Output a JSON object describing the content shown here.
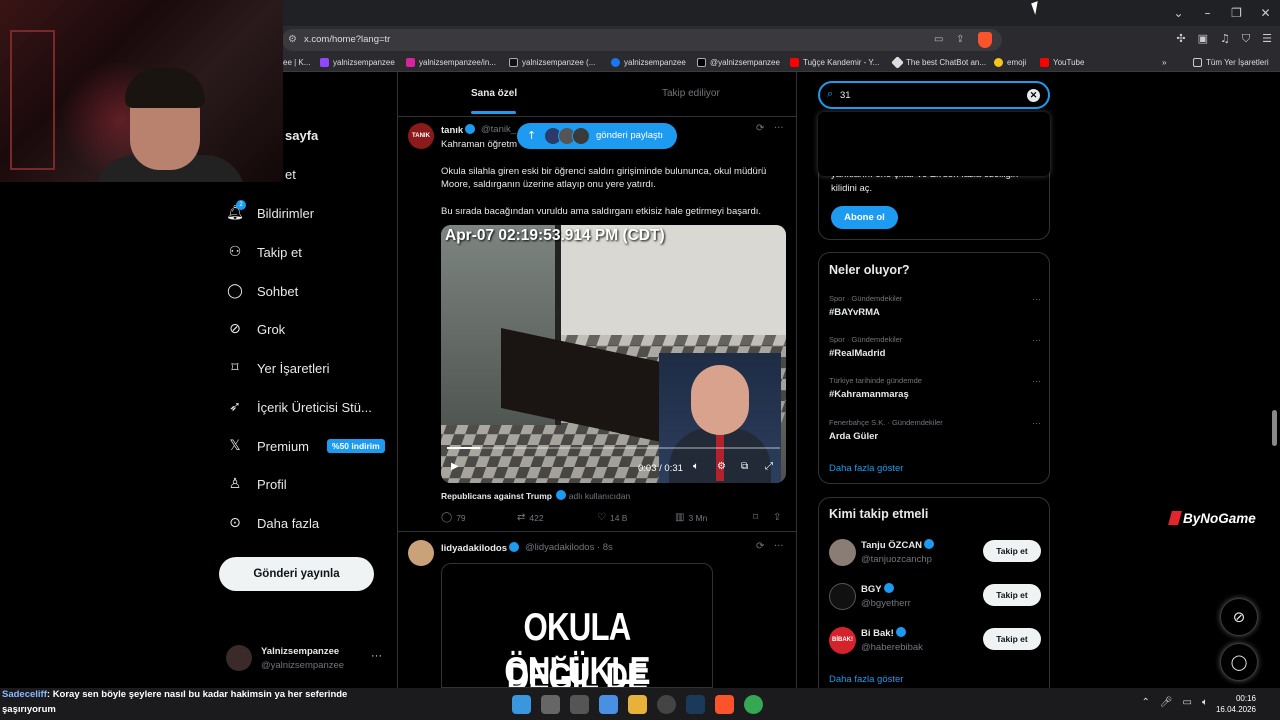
{
  "browser": {
    "url": "x.com/home?lang=tr",
    "bookmarks": [
      "ee | K...",
      "yalnizsempanzee",
      "yalnizsempanzee/in...",
      "yalnizsempanzee (...",
      "yalnizsempanzee",
      "@yalnizsempanzee",
      "Tuğçe Kandemir - Y...",
      "The best ChatBot an...",
      "emoji",
      "YouTube"
    ],
    "all_bookmarks": "Tüm Yer İşaretleri",
    "overflow": "»"
  },
  "nav": {
    "partial_home": "sayfa",
    "partial_explore": "et",
    "items": [
      {
        "label": "Bildirimler",
        "icon": "bell-icon"
      },
      {
        "label": "Takip et",
        "icon": "person-plus-icon"
      },
      {
        "label": "Sohbet",
        "icon": "chat-icon"
      },
      {
        "label": "Grok",
        "icon": "grok-icon"
      },
      {
        "label": "Yer İşaretleri",
        "icon": "bookmark-icon"
      },
      {
        "label": "İçerik Üreticisi Stü...",
        "icon": "rocket-icon"
      },
      {
        "label": "Premium",
        "icon": "x-logo-icon"
      },
      {
        "label": "Profil",
        "icon": "person-icon"
      },
      {
        "label": "Daha fazla",
        "icon": "more-circle-icon"
      }
    ],
    "notif_count": "2",
    "premium_badge": "%50 indirim",
    "post_button": "Gönderi yayınla",
    "account": {
      "name": "Yalnizsempanzee",
      "handle": "@yalnizsempanzee",
      "more": "···"
    }
  },
  "feed": {
    "tabs": [
      "Sana özel",
      "Takip ediliyor"
    ],
    "share_pill": "gönderi paylaştı",
    "tweet1": {
      "avatar_text": "TANIK",
      "name": "tanık",
      "handle": "@tanik_",
      "first_line": "Kahraman öğretm",
      "para1": "Okula silahla giren eski bir öğrenci saldırı girişiminde bulununca, okul müdürü Moore, saldırganın üzerine atlayıp onu yere yatırdı.",
      "para2": "Bu sırada bacağından vuruldu ama saldırganı etkisiz hale getirmeyi başardı.",
      "video_timestamp": "Apr-07 02:19:53.914 PM (CDT)",
      "video_time": "0:03 / 0:31",
      "video_progress": 0.1,
      "source_name": "Republicans against Trump",
      "source_sub": "adlı kullanıcıdan",
      "replies": "79",
      "retweets": "422",
      "likes": "14 B",
      "views": "3 Mn"
    },
    "tweet2": {
      "name": "lidyadakilodos",
      "handle": "@lidyadakilodos",
      "time": "· 8s",
      "image_line1": "OKULA ÖNLÜKLE",
      "image_line2": "DEĞİL DE ÇELİK"
    }
  },
  "search": {
    "value": "31"
  },
  "premium": {
    "text": "yanıtlarını öne çıkar ve Ek'den fazla özelliğin kilidini aç.",
    "button": "Abone ol"
  },
  "trends": {
    "title": "Neler oluyor?",
    "items": [
      {
        "context": "Spor · Gündemdekiler",
        "name": "#BAYvRMA"
      },
      {
        "context": "Spor · Gündemdekiler",
        "name": "#RealMadrid"
      },
      {
        "context": "Türkiye tarihinde gündemde",
        "name": "#Kahramanmaraş"
      },
      {
        "context": "Fenerbahçe S.K. · Gündemdekiler",
        "name": "Arda Güler"
      }
    ],
    "more": "Daha fazla göster"
  },
  "who_to_follow": {
    "title": "Kimi takip etmeli",
    "items": [
      {
        "name": "Tanju ÖZCAN",
        "handle": "@tanjuozcanchp",
        "button": "Takip et"
      },
      {
        "name": "BGY",
        "handle": "@bgyetherr",
        "button": "Takip et"
      },
      {
        "name": "Bi Bak!",
        "handle": "@haberebibak",
        "button": "Takip et",
        "avatar_text": "BİBAK!"
      }
    ],
    "more": "Daha fazla göster"
  },
  "overlay": {
    "brand": "ByNoGame",
    "chat_user": "Sadeceliff",
    "chat_message": ": Koray sen böyle şeylere nasıl bu kadar hakimsin ya her seferinde şaşırıyorum"
  },
  "taskbar": {
    "time": "00:16",
    "date": "16.04.2026"
  },
  "colors": {
    "accent": "#1d9bf0",
    "background": "#000000",
    "border": "#2f3336",
    "muted": "#71767b"
  }
}
